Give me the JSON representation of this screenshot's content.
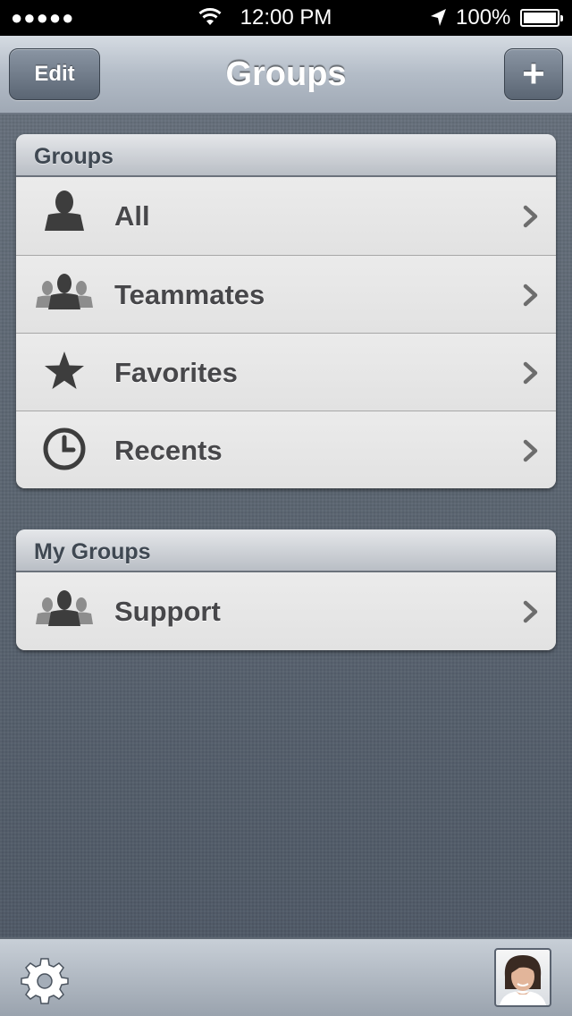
{
  "status_bar": {
    "signal": "●●●●●",
    "time": "12:00 PM",
    "battery": "100%"
  },
  "nav": {
    "title": "Groups",
    "edit_label": "Edit",
    "add_label": "+"
  },
  "groups_section": {
    "header": "Groups",
    "items": [
      {
        "label": "All",
        "icon": "person-icon"
      },
      {
        "label": "Teammates",
        "icon": "people-icon"
      },
      {
        "label": "Favorites",
        "icon": "star-icon"
      },
      {
        "label": "Recents",
        "icon": "clock-icon"
      }
    ]
  },
  "my_groups_section": {
    "header": "My Groups",
    "items": [
      {
        "label": "Support",
        "icon": "people-icon"
      }
    ]
  },
  "toolbar": {
    "settings_icon": "gear-icon",
    "profile_icon": "avatar"
  },
  "colors": {
    "background": "#4f5966",
    "row_text": "#47474a",
    "icon": "#3d3d3d"
  }
}
